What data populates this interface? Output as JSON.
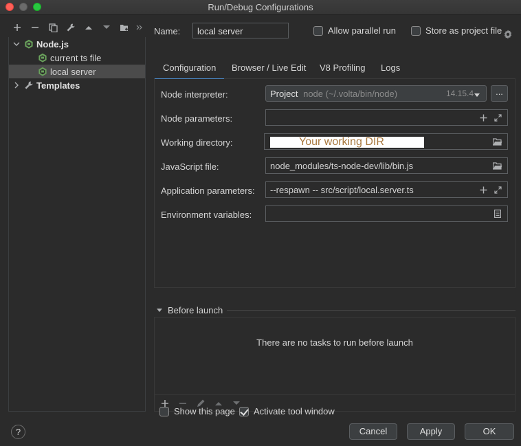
{
  "window": {
    "title": "Run/Debug Configurations"
  },
  "sidebar": {
    "toolbar": [
      "add-icon",
      "remove-icon",
      "copy-icon",
      "wrench-icon",
      "arrow-up-icon",
      "arrow-down-icon",
      "folder-add-icon",
      "more-icon"
    ],
    "tree": {
      "group": "Node.js",
      "items": [
        "current ts file",
        "local server"
      ],
      "selected": "local server",
      "templates": "Templates"
    }
  },
  "header": {
    "name_label": "Name:",
    "name_value": "local server",
    "allow_parallel_label": "Allow parallel run",
    "allow_parallel_checked": false,
    "store_project_label": "Store as project file",
    "store_project_checked": false
  },
  "tabs": [
    "Configuration",
    "Browser / Live Edit",
    "V8 Profiling",
    "Logs"
  ],
  "active_tab": "Configuration",
  "config": {
    "node_interpreter_label": "Node interpreter:",
    "node_interpreter_prefix": "Project",
    "node_interpreter_path": "node (~/.volta/bin/node)",
    "node_interpreter_version": "14.15.4",
    "node_parameters_label": "Node parameters:",
    "node_parameters_value": "",
    "working_directory_label": "Working directory:",
    "working_directory_value": "Your working DIR",
    "javascript_file_label": "JavaScript file:",
    "javascript_file_value": "node_modules/ts-node-dev/lib/bin.js",
    "app_parameters_label": "Application parameters:",
    "app_parameters_value": "--respawn -- src/script/local.server.ts",
    "env_variables_label": "Environment variables:",
    "env_variables_value": ""
  },
  "before_launch": {
    "title": "Before launch",
    "empty_text": "There are no tasks to run before launch"
  },
  "options": {
    "show_this_page_label": "Show this page",
    "show_this_page_checked": false,
    "activate_tool_window_label": "Activate tool window",
    "activate_tool_window_checked": true
  },
  "footer": {
    "help_label": "?",
    "cancel_label": "Cancel",
    "apply_label": "Apply",
    "ok_label": "OK"
  }
}
